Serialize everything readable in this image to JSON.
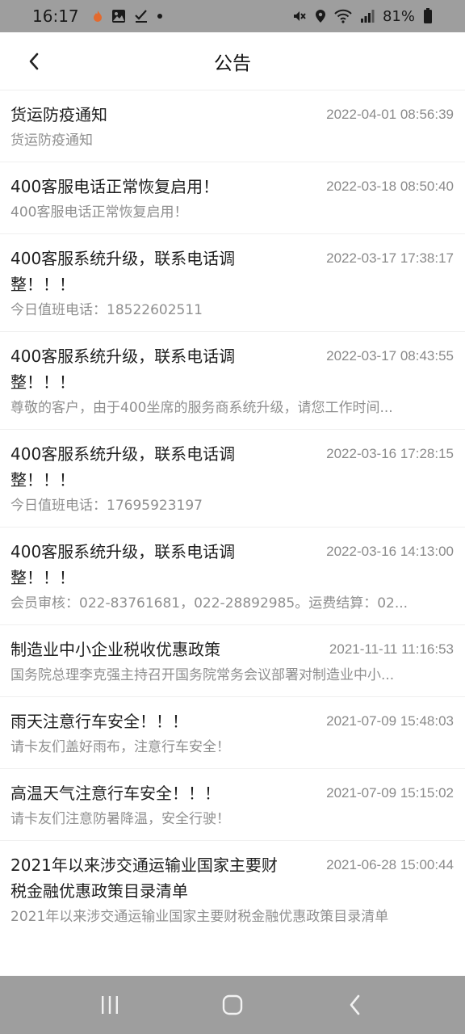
{
  "status_bar": {
    "time": "16:17",
    "battery": "81%",
    "left_icons": [
      "flame-icon",
      "image-icon",
      "check-icon",
      "dot-icon"
    ],
    "right_icons": [
      "mute-icon",
      "location-icon",
      "wifi-icon",
      "signal-icon",
      "battery-icon"
    ]
  },
  "header": {
    "title": "公告"
  },
  "notices": [
    {
      "title": "货运防疫通知",
      "time": "2022-04-01 08:56:39",
      "desc": "货运防疫通知"
    },
    {
      "title": "400客服电话正常恢复启用！",
      "time": "2022-03-18 08:50:40",
      "desc": "400客服电话正常恢复启用！"
    },
    {
      "title": "400客服系统升级，联系电话调整！！！",
      "time": "2022-03-17 17:38:17",
      "desc": "今日值班电话：18522602511"
    },
    {
      "title": "400客服系统升级，联系电话调整！！！",
      "time": "2022-03-17 08:43:55",
      "desc": "尊敬的客户，由于400坐席的服务商系统升级，请您工作时间..."
    },
    {
      "title": "400客服系统升级，联系电话调整！！！",
      "time": "2022-03-16 17:28:15",
      "desc": "今日值班电话：17695923197"
    },
    {
      "title": "400客服系统升级，联系电话调整！！！",
      "time": "2022-03-16 14:13:00",
      "desc": "会员审核：022-83761681，022-28892985。运费结算：02..."
    },
    {
      "title": "制造业中小企业税收优惠政策",
      "time": "2021-11-11 11:16:53",
      "desc": "国务院总理李克强主持召开国务院常务会议部署对制造业中小..."
    },
    {
      "title": "雨天注意行车安全！！！",
      "time": "2021-07-09 15:48:03",
      "desc": "请卡友们盖好雨布，注意行车安全！"
    },
    {
      "title": "高温天气注意行车安全！！！",
      "time": "2021-07-09 15:15:02",
      "desc": "请卡友们注意防暑降温，安全行驶！"
    },
    {
      "title": "2021年以来涉交通运输业国家主要财税金融优惠政策目录清单",
      "time": "2021-06-28 15:00:44",
      "desc": "2021年以来涉交通运输业国家主要财税金融优惠政策目录清单"
    }
  ],
  "nav_bar": {
    "icons": [
      "recents-icon",
      "home-icon",
      "back-nav-icon"
    ]
  },
  "colors": {
    "status_bar_bg": "#9e9e9e",
    "time_text": "#8a8a8a",
    "desc_text": "#8f8f8f",
    "title_text": "#1f1f1f"
  }
}
